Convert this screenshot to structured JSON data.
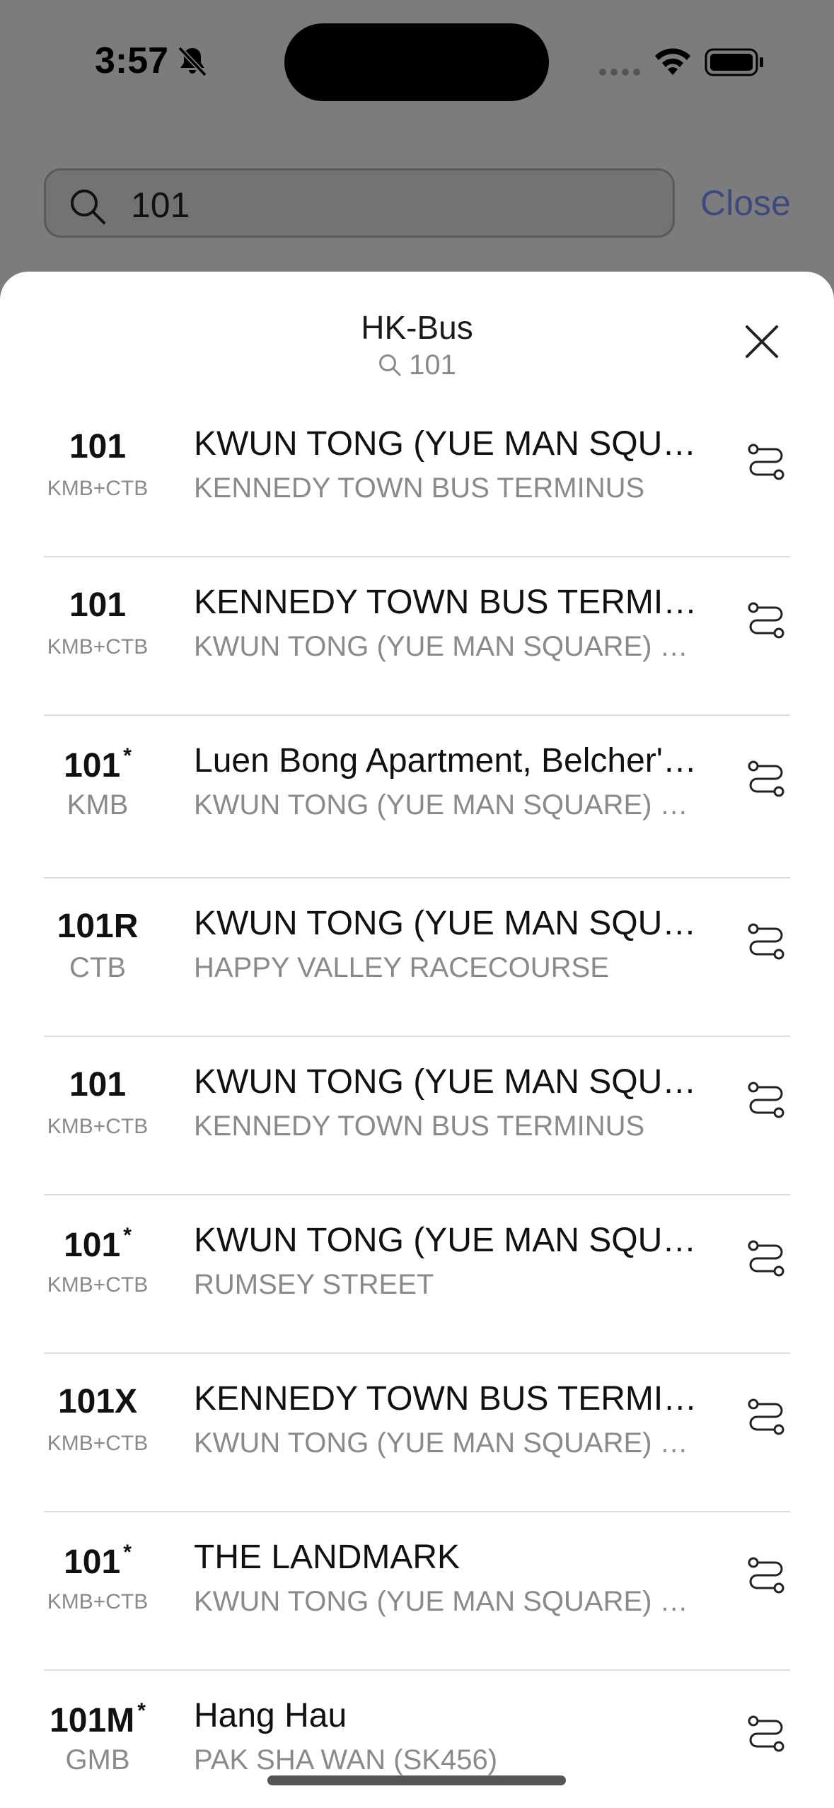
{
  "status_bar": {
    "time": "3:57",
    "icons": [
      "bell-slash-icon",
      "cellular-signal-icon",
      "wifi-icon",
      "battery-icon"
    ]
  },
  "search": {
    "value": "101",
    "close_label": "Close"
  },
  "sheet": {
    "title": "HK-Bus",
    "subtitle": "101",
    "close_icon": "close-icon"
  },
  "routes": [
    {
      "number": "101",
      "star": "",
      "company": "KMB+CTB",
      "destination": "KWUN TONG (YUE MAN SQUARE) BUS TERMINUS",
      "origin": "KENNEDY TOWN BUS TERMINUS"
    },
    {
      "number": "101",
      "star": "",
      "company": "KMB+CTB",
      "destination": "KENNEDY TOWN BUS TERMINUS",
      "origin": "KWUN TONG (YUE MAN SQUARE) BUS TERMINUS"
    },
    {
      "number": "101",
      "star": "*",
      "company": "KMB",
      "destination": "Luen Bong Apartment, Belcher's Street",
      "origin": "KWUN TONG (YUE MAN SQUARE) BUS TERMINUS"
    },
    {
      "number": "101R",
      "star": "",
      "company": "CTB",
      "destination": "KWUN TONG (YUE MAN SQUARE) BUS TERMINUS",
      "origin": "HAPPY VALLEY RACECOURSE"
    },
    {
      "number": "101",
      "star": "",
      "company": "KMB+CTB",
      "destination": "KWUN TONG (YUE MAN SQUARE) BUS TERMINUS",
      "origin": "KENNEDY TOWN BUS TERMINUS"
    },
    {
      "number": "101",
      "star": "*",
      "company": "KMB+CTB",
      "destination": "KWUN TONG (YUE MAN SQUARE) BUS TERMINUS",
      "origin": "RUMSEY STREET"
    },
    {
      "number": "101X",
      "star": "",
      "company": "KMB+CTB",
      "destination": "KENNEDY TOWN BUS TERMINUS",
      "origin": "KWUN TONG (YUE MAN SQUARE) BUS TERMINUS"
    },
    {
      "number": "101",
      "star": "*",
      "company": "KMB+CTB",
      "destination": "THE LANDMARK",
      "origin": "KWUN TONG (YUE MAN SQUARE) BUS TERMINUS"
    },
    {
      "number": "101M",
      "star": "*",
      "company": "GMB",
      "destination": "Hang Hau",
      "origin": "PAK SHA WAN (SK456)"
    }
  ],
  "colors": {
    "dim_background": "#7c7c7e",
    "accent_link": "#3e4980",
    "secondary_text": "#8a8a8e",
    "separator": "#dcdcdc"
  }
}
